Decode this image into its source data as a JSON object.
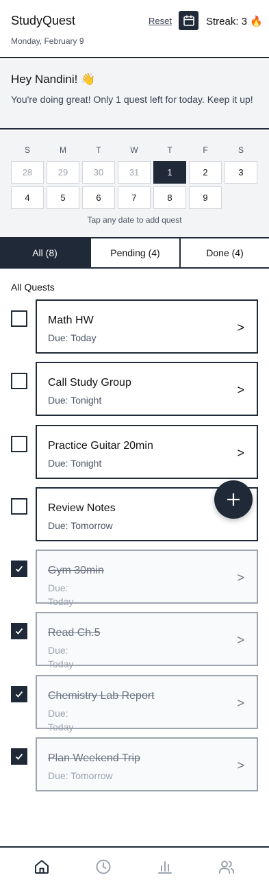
{
  "header": {
    "app_title": "StudyQuest",
    "date": "Monday, February 9",
    "reset_label": "Reset",
    "calendar_icon": "calendar-icon",
    "streak": "Streak: 3 🔥"
  },
  "greeting": {
    "title": "Hey Nandini! 👋",
    "message": "You're doing great! Only 1 quest left for today. Keep it up!"
  },
  "calendar": {
    "weekdays": [
      "S",
      "M",
      "T",
      "W",
      "T",
      "F",
      "S"
    ],
    "days": [
      "28",
      "29",
      "30",
      "31",
      "1",
      "2",
      "3",
      "4",
      "5",
      "6",
      "7",
      "8",
      "9"
    ],
    "selected_day": "1",
    "hint": "Tap any date to add quest"
  },
  "tabs": [
    {
      "label": "All (8)",
      "active": true
    },
    {
      "label": "Pending (4)",
      "active": false
    },
    {
      "label": "Done (4)",
      "active": false
    }
  ],
  "section_label": "All Quests",
  "quests": [
    {
      "title": "Math HW",
      "due": "Due: Today",
      "done": false
    },
    {
      "title": "Call Study Group",
      "due": "Due: Tonight",
      "done": false
    },
    {
      "title": "Practice Guitar 20min",
      "due": "Due: Tonight",
      "done": false
    },
    {
      "title": "Review Notes",
      "due": "Due: Tomorrow",
      "done": false
    },
    {
      "title": "Gym 30min",
      "due": "Due: Today",
      "done": true
    },
    {
      "title": "Read Ch.5",
      "due": "Due: Today",
      "done": true
    },
    {
      "title": "Chemistry Lab Report",
      "due": "Due: Today",
      "done": true
    },
    {
      "title": "Plan Weekend Trip",
      "due": "Due: Tomorrow",
      "done": true
    }
  ],
  "chevron": ">",
  "fab_icon": "plus-icon",
  "bottom_nav": [
    "home-icon",
    "clock-icon",
    "bar-chart-icon",
    "users-icon"
  ],
  "colors": {
    "primary": "#1f2937",
    "background": "#f3f4f6",
    "muted": "#9ca3af"
  }
}
